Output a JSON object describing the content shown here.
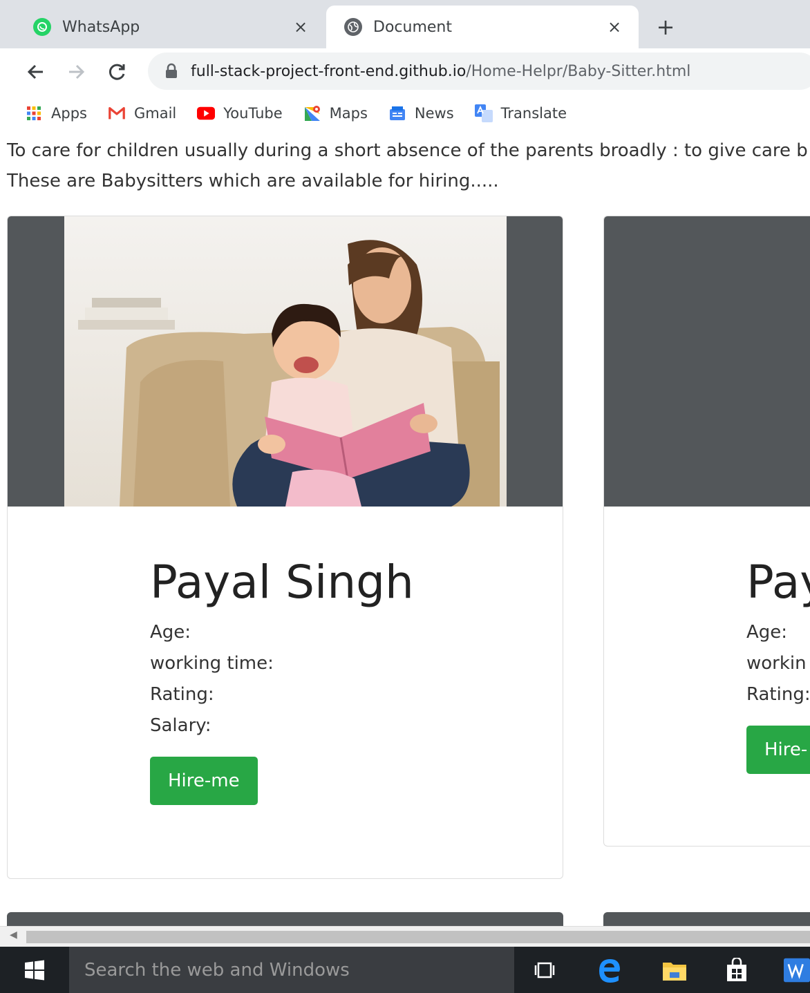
{
  "browser": {
    "tabs": [
      {
        "title": "WhatsApp",
        "active": false,
        "icon": "whatsapp-icon"
      },
      {
        "title": "Document",
        "active": true,
        "icon": "globe-icon"
      }
    ],
    "new_tab": "+",
    "close_glyph": "×",
    "url_host": "full-stack-project-front-end.github.io",
    "url_path": "/Home-Helpr/Baby-Sitter.html",
    "bookmarks": [
      {
        "label": "Apps",
        "icon": "apps-grid-icon"
      },
      {
        "label": "Gmail",
        "icon": "gmail-icon"
      },
      {
        "label": "YouTube",
        "icon": "youtube-icon"
      },
      {
        "label": "Maps",
        "icon": "maps-icon"
      },
      {
        "label": "News",
        "icon": "news-icon"
      },
      {
        "label": "Translate",
        "icon": "translate-icon"
      }
    ]
  },
  "page": {
    "intro_line1": "To care for children usually during a short absence of the parents broadly : to give care b",
    "intro_line2": "These are Babysitters which are available for hiring.....",
    "cards": [
      {
        "name": "Payal Singh",
        "age_label": "Age:",
        "working_time_label": "working time:",
        "rating_label": "Rating:",
        "salary_label": "Salary:",
        "button": "Hire-me"
      },
      {
        "name": "Pay",
        "age_label": "Age:",
        "working_time_label": "workin",
        "rating_label": "Rating:",
        "button": "Hire-"
      }
    ]
  },
  "taskbar": {
    "search_placeholder": "Search the web and Windows"
  },
  "colors": {
    "hire_green": "#28a745",
    "photo_gray": "#53575a",
    "taskbar": "#1d2125"
  }
}
